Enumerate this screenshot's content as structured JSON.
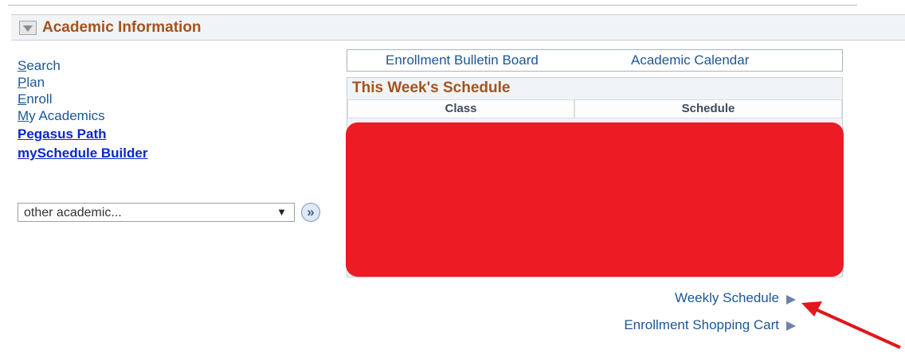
{
  "section": {
    "title": "Academic Information"
  },
  "nav": {
    "search": {
      "accel": "S",
      "rest": "earch"
    },
    "plan": {
      "accel": "P",
      "rest": "lan"
    },
    "enroll": {
      "accel": "E",
      "rest": "nroll"
    },
    "my_academics": {
      "accel": "M",
      "rest": "y Academics"
    },
    "pegasus_path": "Pegasus Path",
    "myschedule_builder": "mySchedule Builder"
  },
  "other_select": {
    "value": "other academic...",
    "arrow": "▼",
    "go_glyph": "»"
  },
  "top_links": {
    "bulletin": "Enrollment Bulletin Board",
    "calendar": "Academic Calendar"
  },
  "schedule": {
    "title": "This Week's Schedule",
    "columns": [
      "Class",
      "Schedule"
    ]
  },
  "bottom_links": {
    "weekly": "Weekly Schedule",
    "cart": "Enrollment Shopping Cart"
  },
  "colors": {
    "accent_title": "#a6521c",
    "link": "#1b5796",
    "bold_link": "#0a27c9",
    "redaction": "#ed1c24",
    "annotation_arrow": "#e2161b"
  },
  "icons": {
    "collapse": "collapse-triangle-icon",
    "go": "double-chevron-right-icon",
    "play": "play-triangle-icon"
  }
}
